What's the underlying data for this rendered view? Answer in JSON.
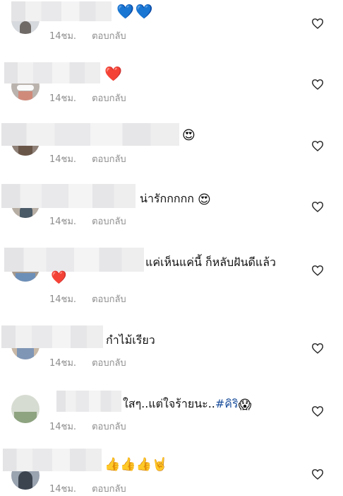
{
  "comments": [
    {
      "text": "",
      "emoji": "💙💙",
      "time": "14ชม.",
      "reply": "ตอบกลับ"
    },
    {
      "text": "",
      "emoji": "❤️",
      "time": "14ชม.",
      "reply": "ตอบกลับ"
    },
    {
      "text": "",
      "emoji": "😍",
      "time": "14ชม.",
      "reply": "ตอบกลับ"
    },
    {
      "text": "น่ารักกกกก",
      "emoji": "😍",
      "time": "14ชม.",
      "reply": "ตอบกลับ"
    },
    {
      "text": "แค่เห็นแค่นี้ ก็หลับฝันดีแล้ว",
      "emoji": "❤️",
      "time": "14ชม.",
      "reply": "ตอบกลับ"
    },
    {
      "text": "กำไม้เรียว",
      "emoji": "",
      "time": "14ชม.",
      "reply": "ตอบกลับ"
    },
    {
      "text": "ใสๆ..แต่ใจร้ายนะ..",
      "hashtag": "#คิริ",
      "emoji": "😱",
      "time": "14ชม.",
      "reply": "ตอบกลับ"
    },
    {
      "text": "",
      "emoji": "👍👍👍🤘",
      "time": "14ชม.",
      "reply": "ตอบกลับ"
    }
  ],
  "colors": {
    "meta": "#8e8e8e",
    "hashtag": "#1b4f9c",
    "like_outline": "#262626"
  },
  "icons": {
    "like": "heart-outline-icon"
  }
}
